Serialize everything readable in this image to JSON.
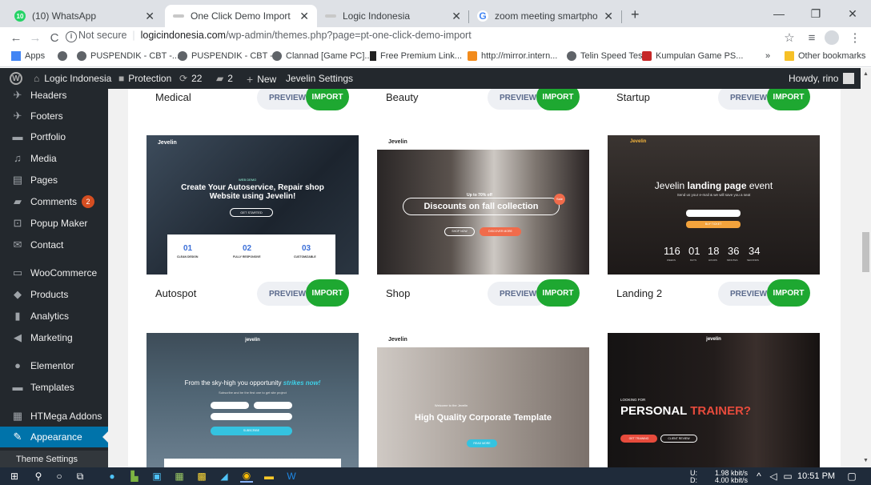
{
  "browser": {
    "tabs": [
      {
        "title": "(10) WhatsApp",
        "favicon": "whatsapp-icon",
        "active": false
      },
      {
        "title": "One Click Demo Import ‹ Logic I",
        "favicon": "site-icon",
        "active": true
      },
      {
        "title": "Logic Indonesia",
        "favicon": "site-icon",
        "active": false
      },
      {
        "title": "zoom meeting smartphone - Goo",
        "favicon": "google-icon",
        "active": false
      }
    ],
    "new_tab": "+",
    "security": "Not secure",
    "url_host": "logicindonesia.com",
    "url_path": "/wp-admin/themes.php?page=pt-one-click-demo-import",
    "bookmarks": [
      "Apps",
      "PUSPENDIK - CBT -...",
      "PUSPENDIK - CBT -...",
      "Clannad [Game PC]...",
      "Free Premium Link...",
      "http://mirror.intern...",
      "Telin Speed Test",
      "Kumpulan Game PS..."
    ],
    "bookmarks_more": "»",
    "other_bookmarks": "Other bookmarks"
  },
  "adminbar": {
    "site": "Logic Indonesia",
    "protection": "Protection",
    "updates": "22",
    "comments": "2",
    "new": "New",
    "settings": "Jevelin Settings",
    "howdy": "Howdy, rino"
  },
  "sidebar": {
    "items": [
      {
        "label": "Headers",
        "icon": "pin-icon"
      },
      {
        "label": "Footers",
        "icon": "pin-icon"
      },
      {
        "label": "Portfolio",
        "icon": "folder-icon"
      },
      {
        "label": "Media",
        "icon": "media-icon"
      },
      {
        "label": "Pages",
        "icon": "pages-icon"
      },
      {
        "label": "Comments",
        "icon": "comment-icon",
        "badge": "2"
      },
      {
        "label": "Popup Maker",
        "icon": "popup-icon"
      },
      {
        "label": "Contact",
        "icon": "mail-icon"
      },
      {
        "label": "WooCommerce",
        "icon": "woo-icon"
      },
      {
        "label": "Products",
        "icon": "products-icon"
      },
      {
        "label": "Analytics",
        "icon": "analytics-icon"
      },
      {
        "label": "Marketing",
        "icon": "megaphone-icon"
      },
      {
        "label": "Elementor",
        "icon": "elementor-icon"
      },
      {
        "label": "Templates",
        "icon": "folder-icon"
      },
      {
        "label": "HTMega Addons",
        "icon": "addons-icon"
      },
      {
        "label": "Appearance",
        "icon": "brush-icon"
      },
      {
        "label": "Theme Settings",
        "icon": ""
      }
    ]
  },
  "demos": {
    "preview_label": "PREVIEW",
    "import_label": "IMPORT",
    "row1": [
      "Medical",
      "Beauty",
      "Startup"
    ],
    "row2": [
      {
        "name": "Autospot",
        "thumb": {
          "brand": "Jevelin",
          "kicker": "WEB DEMO",
          "heading": "Create Your Autoservice, Repair shop Website using Jevelin!",
          "button": "GET STARTED",
          "features": [
            {
              "num": "01",
              "label": "CLEAN DESIGN"
            },
            {
              "num": "02",
              "label": "FULLY RESPONSIVE"
            },
            {
              "num": "03",
              "label": "CUSTOMIZABLE"
            }
          ]
        }
      },
      {
        "name": "Shop",
        "thumb": {
          "brand": "Jevelin",
          "promo_small": "Up to 70% off",
          "promo": "Discounts on fall collection",
          "tag": "Sale",
          "btn1": "SHOP NOW",
          "btn2": "DISCOVER MORE"
        }
      },
      {
        "name": "Landing 2",
        "thumb": {
          "brand": "Jevelin",
          "heading_pre": "Jevelin ",
          "heading_bold": "landing page",
          "heading_post": " event",
          "sub": "Send us your e-mail & we will save you a seat",
          "btn": "BUY TICKET",
          "countdown": [
            {
              "v": "116",
              "l": "WEEKS"
            },
            {
              "v": "01",
              "l": "DAYS"
            },
            {
              "v": "18",
              "l": "HOURS"
            },
            {
              "v": "36",
              "l": "MINUTES"
            },
            {
              "v": "34",
              "l": "SECONDS"
            }
          ]
        }
      }
    ],
    "row3": [
      {
        "brand": "jevelin",
        "heading_pre": "From the sky-high you opportunity ",
        "heading_em": "strikes now!",
        "sub": "Subscribe and be the first one to get site project",
        "btn": "SUBSCRIBE"
      },
      {
        "brand": "Jevelin",
        "small": "Welcome to the Jevelin",
        "heading": "High Quality Corporate Template",
        "btn": "READ MORE"
      },
      {
        "brand": "jevelin",
        "kicker": "LOOKING FOR",
        "heading_white": "PERSONAL ",
        "heading_red": "TRAINER?",
        "btn1": "GET TRAINING",
        "btn2": "CLIENT REVIEW"
      }
    ]
  },
  "taskbar": {
    "net_up_label": "U:",
    "net_up": "1.98 kbit/s",
    "net_down_label": "D:",
    "net_down": "4.00 kbit/s",
    "time": "10:51 PM"
  }
}
